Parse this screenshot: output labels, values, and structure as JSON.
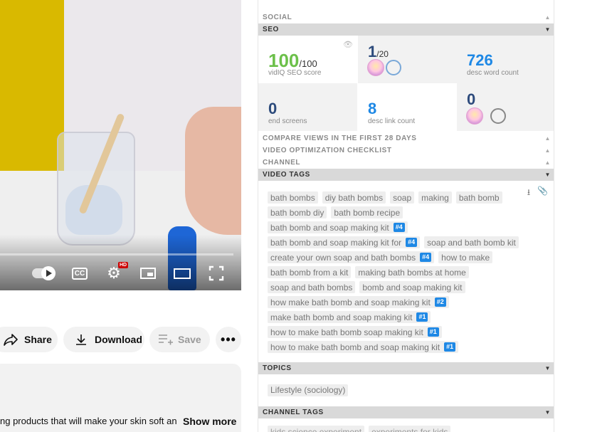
{
  "actions": {
    "share": "Share",
    "download": "Download",
    "save": "Save"
  },
  "description": {
    "snippet": "ng products that will make your skin soft an",
    "show_more": "Show more"
  },
  "player": {
    "hd_badge": "HD",
    "cc_label": "CC"
  },
  "panel": {
    "sections": {
      "social": "SOCIAL",
      "seo": "SEO",
      "compare_views": "COMPARE VIEWS IN THE FIRST 28 DAYS",
      "checklist": "VIDEO OPTIMIZATION CHECKLIST",
      "channel": "CHANNEL",
      "video_tags": "VIDEO TAGS",
      "topics": "TOPICS",
      "channel_tags": "CHANNEL TAGS"
    },
    "seo": {
      "score": "100",
      "score_max": "/100",
      "score_label": "vidIQ SEO score",
      "rank": "1",
      "rank_of": "/20",
      "desc_words": "726",
      "desc_words_label": "desc word count",
      "end_screens": "0",
      "end_screens_label": "end screens",
      "desc_links": "8",
      "desc_links_label": "desc link count",
      "subscribe_links": "0"
    },
    "video_tags": [
      [
        {
          "text": "bath bombs"
        },
        {
          "text": "diy bath bombs"
        },
        {
          "text": "soap"
        },
        {
          "text": "making"
        },
        {
          "text": "bath bomb"
        }
      ],
      [
        {
          "text": "bath bomb diy"
        },
        {
          "text": "bath bomb recipe"
        }
      ],
      [
        {
          "text": "bath bomb and soap making kit",
          "rank": "#4"
        }
      ],
      [
        {
          "text": "bath bomb and soap making kit for",
          "rank": "#4"
        },
        {
          "text": "soap and bath bomb kit"
        }
      ],
      [
        {
          "text": "create your own soap and bath bombs",
          "rank": "#4"
        },
        {
          "text": "how to make"
        }
      ],
      [
        {
          "text": "bath bomb from a kit"
        },
        {
          "text": "making bath bombs at home"
        }
      ],
      [
        {
          "text": "soap and bath bombs"
        },
        {
          "text": "bomb and soap making kit"
        }
      ],
      [
        {
          "text": "how make bath bomb and soap making kit",
          "rank": "#2"
        }
      ],
      [
        {
          "text": "make bath bomb and soap making kit",
          "rank": "#1"
        }
      ],
      [
        {
          "text": "how to make bath bomb soap making kit",
          "rank": "#1"
        }
      ],
      [
        {
          "text": "how to make bath bomb and soap making kit",
          "rank": "#1"
        }
      ]
    ],
    "topics": [
      "Lifestyle (sociology)"
    ],
    "channel_tags_partial": [
      "kids science experiment",
      "experiments for kids"
    ]
  }
}
